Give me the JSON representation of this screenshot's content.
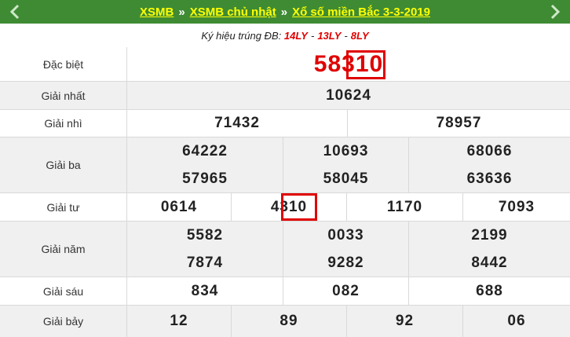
{
  "header": {
    "breadcrumbs": [
      "XSMB",
      "XSMB chủ nhật",
      "Xổ số miền Bắc 3-3-2019"
    ],
    "separator": "»",
    "prev_icon": "chevron-left-icon",
    "next_icon": "chevron-right-icon",
    "bg_color": "#3f8b34",
    "link_color": "#ffff00"
  },
  "subtitle": {
    "label": "Ký hiệu trúng ĐB:",
    "codes": [
      "14LY",
      "13LY",
      "8LY"
    ],
    "sep": "-"
  },
  "results": {
    "special": {
      "label": "Đặc biệt",
      "numbers": [
        "58310"
      ]
    },
    "first": {
      "label": "Giải nhất",
      "numbers": [
        "10624"
      ]
    },
    "second": {
      "label": "Giải nhì",
      "numbers": [
        "71432",
        "78957"
      ]
    },
    "third": {
      "label": "Giải ba",
      "numbers": [
        "64222",
        "10693",
        "68066",
        "57965",
        "58045",
        "63636"
      ]
    },
    "fourth": {
      "label": "Giải tư",
      "numbers": [
        "0614",
        "4310",
        "1170",
        "7093"
      ]
    },
    "fifth": {
      "label": "Giải năm",
      "numbers": [
        "5582",
        "0033",
        "2199",
        "7874",
        "9282",
        "8442"
      ]
    },
    "sixth": {
      "label": "Giải sáu",
      "numbers": [
        "834",
        "082",
        "688"
      ]
    },
    "seventh": {
      "label": "Giải bảy",
      "numbers": [
        "12",
        "89",
        "92",
        "06"
      ]
    }
  },
  "colors": {
    "special": "#e00000",
    "highlight_box": "#e00000",
    "row_alt": "#f0f0f0"
  }
}
